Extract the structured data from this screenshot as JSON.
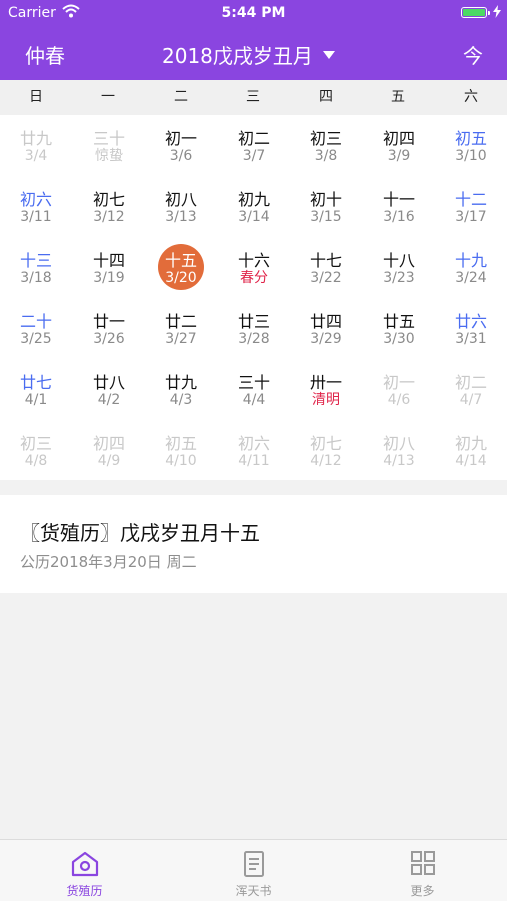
{
  "status_bar": {
    "carrier": "Carrier",
    "time": "5:44 PM"
  },
  "nav": {
    "left": "仲春",
    "title": "2018戊戌岁丑月",
    "right": "今"
  },
  "weekdays": [
    "日",
    "一",
    "二",
    "三",
    "四",
    "五",
    "六"
  ],
  "colors": {
    "header": "#8a45e0",
    "weekend": "#4a6cf0",
    "normal": "#111111",
    "faded": "#c8c8c8",
    "term": "#e0254a",
    "selected": "#e26c3a",
    "tab_active": "#8a45e0",
    "tab_inactive": "#9a9a9a"
  },
  "calendar": {
    "rows": [
      [
        {
          "lunar": "廿九",
          "solar": "3/4",
          "faded": true
        },
        {
          "lunar": "三十",
          "solar": "惊蛰",
          "faded": true
        },
        {
          "lunar": "初一",
          "solar": "3/6"
        },
        {
          "lunar": "初二",
          "solar": "3/7"
        },
        {
          "lunar": "初三",
          "solar": "3/8"
        },
        {
          "lunar": "初四",
          "solar": "3/9"
        },
        {
          "lunar": "初五",
          "solar": "3/10"
        }
      ],
      [
        {
          "lunar": "初六",
          "solar": "3/11"
        },
        {
          "lunar": "初七",
          "solar": "3/12"
        },
        {
          "lunar": "初八",
          "solar": "3/13"
        },
        {
          "lunar": "初九",
          "solar": "3/14"
        },
        {
          "lunar": "初十",
          "solar": "3/15"
        },
        {
          "lunar": "十一",
          "solar": "3/16"
        },
        {
          "lunar": "十二",
          "solar": "3/17"
        }
      ],
      [
        {
          "lunar": "十三",
          "solar": "3/18"
        },
        {
          "lunar": "十四",
          "solar": "3/19"
        },
        {
          "lunar": "十五",
          "solar": "3/20",
          "selected": true
        },
        {
          "lunar": "十六",
          "solar": "春分",
          "term": true
        },
        {
          "lunar": "十七",
          "solar": "3/22"
        },
        {
          "lunar": "十八",
          "solar": "3/23"
        },
        {
          "lunar": "十九",
          "solar": "3/24"
        }
      ],
      [
        {
          "lunar": "二十",
          "solar": "3/25"
        },
        {
          "lunar": "廿一",
          "solar": "3/26"
        },
        {
          "lunar": "廿二",
          "solar": "3/27"
        },
        {
          "lunar": "廿三",
          "solar": "3/28"
        },
        {
          "lunar": "廿四",
          "solar": "3/29"
        },
        {
          "lunar": "廿五",
          "solar": "3/30"
        },
        {
          "lunar": "廿六",
          "solar": "3/31"
        }
      ],
      [
        {
          "lunar": "廿七",
          "solar": "4/1"
        },
        {
          "lunar": "廿八",
          "solar": "4/2"
        },
        {
          "lunar": "廿九",
          "solar": "4/3"
        },
        {
          "lunar": "三十",
          "solar": "4/4"
        },
        {
          "lunar": "卅一",
          "solar": "清明",
          "term": true
        },
        {
          "lunar": "初一",
          "solar": "4/6",
          "faded": true
        },
        {
          "lunar": "初二",
          "solar": "4/7",
          "faded": true
        }
      ],
      [
        {
          "lunar": "初三",
          "solar": "4/8",
          "faded": true
        },
        {
          "lunar": "初四",
          "solar": "4/9",
          "faded": true
        },
        {
          "lunar": "初五",
          "solar": "4/10",
          "faded": true
        },
        {
          "lunar": "初六",
          "solar": "4/11",
          "faded": true
        },
        {
          "lunar": "初七",
          "solar": "4/12",
          "faded": true
        },
        {
          "lunar": "初八",
          "solar": "4/13",
          "faded": true
        },
        {
          "lunar": "初九",
          "solar": "4/14",
          "faded": true
        }
      ]
    ]
  },
  "detail": {
    "title": "〖货殖历〗戊戌岁丑月十五",
    "subtitle": "公历2018年3月20日 周二"
  },
  "tabs": [
    {
      "label": "货殖历",
      "icon": "house-icon",
      "active": true
    },
    {
      "label": "浑天书",
      "icon": "book-icon",
      "active": false
    },
    {
      "label": "更多",
      "icon": "grid-icon",
      "active": false
    }
  ]
}
